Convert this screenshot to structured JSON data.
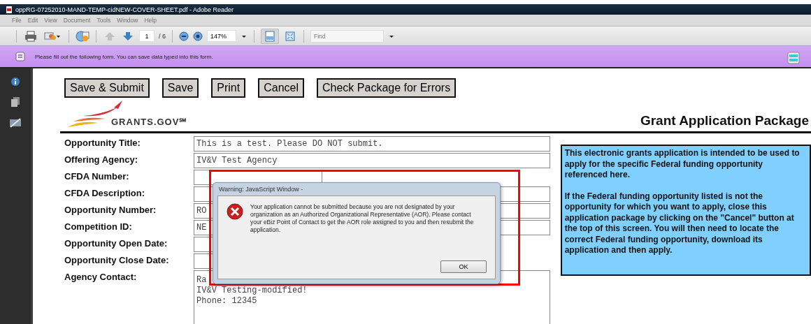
{
  "window": {
    "title": "oppRG-07252010-MAND-TEMP-cidNEW-COVER-SHEET.pdf - Adobe Reader"
  },
  "menu": [
    "File",
    "Edit",
    "View",
    "Document",
    "Tools",
    "Window",
    "Help"
  ],
  "toolbar": {
    "page": "1",
    "page_count": "/ 6",
    "zoom": "147%",
    "find_placeholder": "Find",
    "nav": [
      {
        "kind": "up",
        "disabled": true
      },
      {
        "kind": "down",
        "disabled": false
      }
    ],
    "view_modes": [
      {
        "kind": "fit-width",
        "selected": true
      },
      {
        "kind": "fit-page",
        "selected": false
      }
    ]
  },
  "form_bar": {
    "message": "Please fill out the following form. You can save data typed into this form."
  },
  "form_buttons": [
    "Save & Submit",
    "Save",
    "Print",
    "Cancel",
    "Check Package for Errors"
  ],
  "logo": {
    "text": "GRANTS.GOV℠"
  },
  "heading": "Grant Application Package",
  "fields": [
    {
      "label": "Opportunity Title:",
      "kind": "text",
      "value": "This is a test. Please DO NOT submit."
    },
    {
      "label": "Offering Agency:",
      "kind": "text",
      "value": "IV&V Test Agency"
    },
    {
      "label": "CFDA Number:",
      "kind": "short"
    },
    {
      "label": "CFDA Description:",
      "kind": "text"
    },
    {
      "label": "Opportunity Number:",
      "kind": "text",
      "value": "RO"
    },
    {
      "label": "Competition ID:",
      "kind": "text",
      "value": "NE"
    },
    {
      "label": "Opportunity Open Date:",
      "kind": "short"
    },
    {
      "label": "Opportunity Close Date:",
      "kind": "short"
    },
    {
      "label": "Agency Contact:",
      "kind": "multiline",
      "lines": [
        "Ra",
        "IV&V Testing-modified!",
        "Phone: 12345"
      ]
    }
  ],
  "info_box": {
    "paragraphs": [
      "This electronic grants application is intended to be used to apply for the specific Federal funding opportunity referenced here.",
      "If the Federal funding opportunity listed is not the opportunity for which you want to apply, close this application package by clicking on the \"Cancel\" button at the top of this screen. You will  then need to locate the correct Federal funding opportunity, download its application and then apply."
    ]
  },
  "dialog": {
    "title": "Warning: JavaScript Window -",
    "message": "Your application cannot be submitted because you are not designated by your organization as an Authorized Organizational Representative (AOR). Please contact your eBiz Point of Contact to get the AOR role assigned to you and then resubmit the application.",
    "button": "OK"
  }
}
